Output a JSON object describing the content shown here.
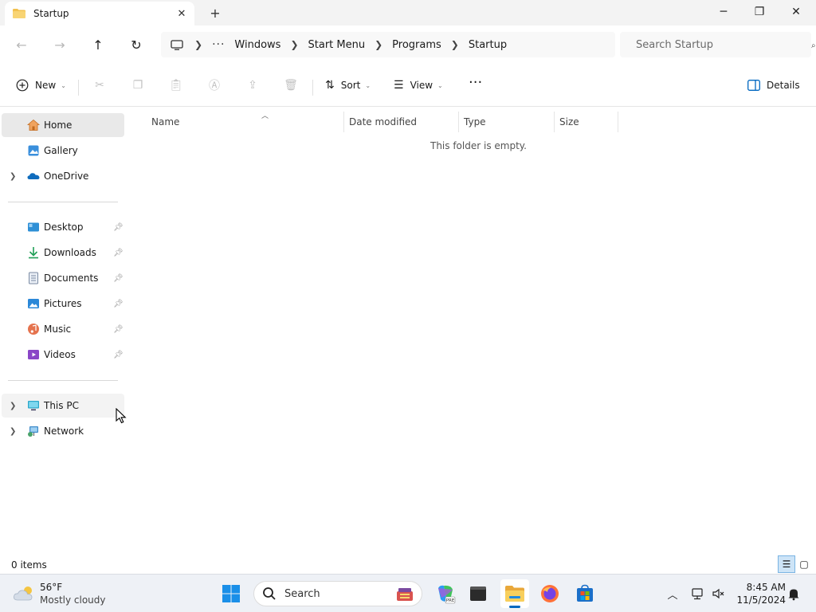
{
  "window": {
    "tab_title": "Startup",
    "tab_close": "✕",
    "new_tab": "+"
  },
  "window_controls": {
    "minimize": "─",
    "maximize": "❐",
    "close": "✕"
  },
  "navigation": {
    "back": "←",
    "forward": "→",
    "up": "↑",
    "refresh": "↻"
  },
  "breadcrumb": {
    "overflow": "···",
    "items": [
      "Windows",
      "Start Menu",
      "Programs",
      "Startup"
    ]
  },
  "search": {
    "placeholder": "Search Startup"
  },
  "commandbar": {
    "new_label": "New",
    "sort_label": "Sort",
    "view_label": "View",
    "more": "···",
    "details_label": "Details"
  },
  "sidebar": {
    "top": [
      {
        "label": "Home",
        "icon": "home-icon"
      },
      {
        "label": "Gallery",
        "icon": "gallery-icon"
      },
      {
        "label": "OneDrive",
        "icon": "onedrive-icon"
      }
    ],
    "quick_access": [
      {
        "label": "Desktop",
        "icon": "desktop-icon"
      },
      {
        "label": "Downloads",
        "icon": "downloads-icon"
      },
      {
        "label": "Documents",
        "icon": "documents-icon"
      },
      {
        "label": "Pictures",
        "icon": "pictures-icon"
      },
      {
        "label": "Music",
        "icon": "music-icon"
      },
      {
        "label": "Videos",
        "icon": "videos-icon"
      }
    ],
    "devices": [
      {
        "label": "This PC",
        "icon": "this-pc-icon"
      },
      {
        "label": "Network",
        "icon": "network-icon"
      }
    ]
  },
  "file_list": {
    "columns": [
      "Name",
      "Date modified",
      "Type",
      "Size"
    ],
    "empty_message": "This folder is empty."
  },
  "status": {
    "item_count": "0 items"
  },
  "taskbar": {
    "weather_temp": "56°F",
    "weather_desc": "Mostly cloudy",
    "search_label": "Search",
    "time": "8:45 AM",
    "date": "11/5/2024"
  },
  "colors": {
    "accent": "#0067c0",
    "folder": "#f2c14e",
    "selected_bg": "#e9e9e9"
  }
}
